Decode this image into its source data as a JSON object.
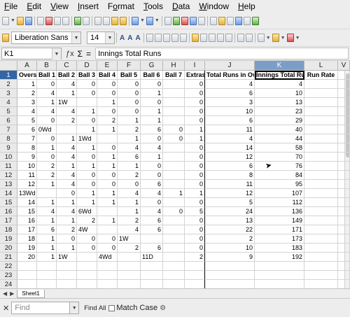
{
  "menubar": {
    "items": [
      {
        "label": "File",
        "acc": "F",
        "rest": "ile"
      },
      {
        "label": "Edit",
        "acc": "E",
        "rest": "dit"
      },
      {
        "label": "View",
        "acc": "V",
        "rest": "iew"
      },
      {
        "label": "Insert",
        "acc": "I",
        "rest": "nsert"
      },
      {
        "label": "Format",
        "acc": "o",
        "pre": "F",
        "rest": "rmat"
      },
      {
        "label": "Tools",
        "acc": "T",
        "rest": "ools"
      },
      {
        "label": "Data",
        "acc": "D",
        "rest": "ata"
      },
      {
        "label": "Window",
        "acc": "W",
        "rest": "indow"
      },
      {
        "label": "Help",
        "acc": "H",
        "rest": "elp"
      }
    ]
  },
  "toolbar": {
    "font_name": "Liberation Sans",
    "font_size": "14"
  },
  "formula": {
    "name_box": "K1",
    "content": "Innings Total Runs"
  },
  "columns": [
    "A",
    "B",
    "C",
    "D",
    "E",
    "F",
    "G",
    "H",
    "I",
    "J",
    "K",
    "L",
    "V"
  ],
  "selected_column": "K",
  "header_row": [
    "Overs",
    "Ball 1",
    "Ball 2",
    "Ball 3",
    "Ball 4",
    "Ball 5",
    "Ball 6",
    "Ball 7",
    "Extras",
    "Total Runs in Over",
    "Innings Total Runs",
    "Run Rate",
    ""
  ],
  "rows": [
    [
      "1",
      "0",
      "4",
      "0",
      "0",
      "0",
      "0",
      "",
      "0",
      "4",
      "4",
      "",
      ""
    ],
    [
      "2",
      "4",
      "1",
      "0",
      "0",
      "0",
      "1",
      "",
      "0",
      "6",
      "10",
      "",
      ""
    ],
    [
      "3",
      "1",
      "1W",
      "",
      "1",
      "0",
      "0",
      "",
      "0",
      "3",
      "13",
      "",
      ""
    ],
    [
      "4",
      "4",
      "4",
      "1",
      "0",
      "0",
      "1",
      "",
      "0",
      "10",
      "23",
      "",
      ""
    ],
    [
      "5",
      "0",
      "2",
      "0",
      "2",
      "1",
      "1",
      "",
      "0",
      "6",
      "29",
      "",
      ""
    ],
    [
      "6",
      "0Wd",
      "",
      "1",
      "1",
      "2",
      "6",
      "0",
      "1",
      "11",
      "40",
      "",
      ""
    ],
    [
      "7",
      "0",
      "1",
      "1Wd",
      "",
      "1",
      "0",
      "0",
      "1",
      "4",
      "44",
      "",
      ""
    ],
    [
      "8",
      "1",
      "4",
      "1",
      "0",
      "4",
      "4",
      "",
      "0",
      "14",
      "58",
      "",
      ""
    ],
    [
      "9",
      "0",
      "4",
      "0",
      "1",
      "6",
      "1",
      "",
      "0",
      "12",
      "70",
      "",
      ""
    ],
    [
      "10",
      "2",
      "1",
      "1",
      "1",
      "1",
      "0",
      "",
      "0",
      "6",
      "76",
      "",
      ""
    ],
    [
      "11",
      "2",
      "4",
      "0",
      "0",
      "2",
      "0",
      "",
      "0",
      "8",
      "84",
      "",
      ""
    ],
    [
      "12",
      "1",
      "4",
      "0",
      "0",
      "0",
      "6",
      "",
      "0",
      "11",
      "95",
      "",
      ""
    ],
    [
      "13Wd",
      "",
      "0",
      "1",
      "1",
      "4",
      "4",
      "1",
      "1",
      "12",
      "107",
      "",
      ""
    ],
    [
      "14",
      "1",
      "1",
      "1",
      "1",
      "1",
      "0",
      "",
      "0",
      "5",
      "112",
      "",
      ""
    ],
    [
      "15",
      "4",
      "4",
      "6Wd",
      "",
      "1",
      "4",
      "0",
      "5",
      "24",
      "136",
      "",
      ""
    ],
    [
      "16",
      "1",
      "1",
      "2",
      "1",
      "2",
      "6",
      "",
      "0",
      "13",
      "149",
      "",
      ""
    ],
    [
      "17",
      "6",
      "2",
      "4W",
      "",
      "4",
      "6",
      "",
      "0",
      "22",
      "171",
      "",
      ""
    ],
    [
      "18",
      "1",
      "0",
      "0",
      "0",
      "1W",
      "",
      "",
      "0",
      "2",
      "173",
      "",
      ""
    ],
    [
      "19",
      "1",
      "1",
      "0",
      "0",
      "2",
      "6",
      "",
      "0",
      "10",
      "183",
      "",
      ""
    ],
    [
      "20",
      "1",
      "1W",
      "",
      "4Wd",
      "",
      "11D",
      "",
      "2",
      "9",
      "192",
      "",
      ""
    ],
    [
      "",
      "",
      "",
      "",
      "",
      "",
      "",
      "",
      "",
      "",
      "",
      "",
      ""
    ],
    [
      "",
      "",
      "",
      "",
      "",
      "",
      "",
      "",
      "",
      "",
      "",
      "",
      ""
    ],
    [
      "",
      "",
      "",
      "",
      "",
      "",
      "",
      "",
      "",
      "",
      "",
      "",
      ""
    ]
  ],
  "row_numbers": [
    "1",
    "2",
    "3",
    "4",
    "5",
    "6",
    "7",
    "8",
    "9",
    "10",
    "11",
    "12",
    "13",
    "14",
    "15",
    "16",
    "17",
    "18",
    "19",
    "20",
    "21",
    "22",
    "23",
    "24"
  ],
  "sheet_tab": "Sheet1",
  "findbar": {
    "placeholder": "Find",
    "find_all": "Find All",
    "match_case": "Match Case"
  }
}
